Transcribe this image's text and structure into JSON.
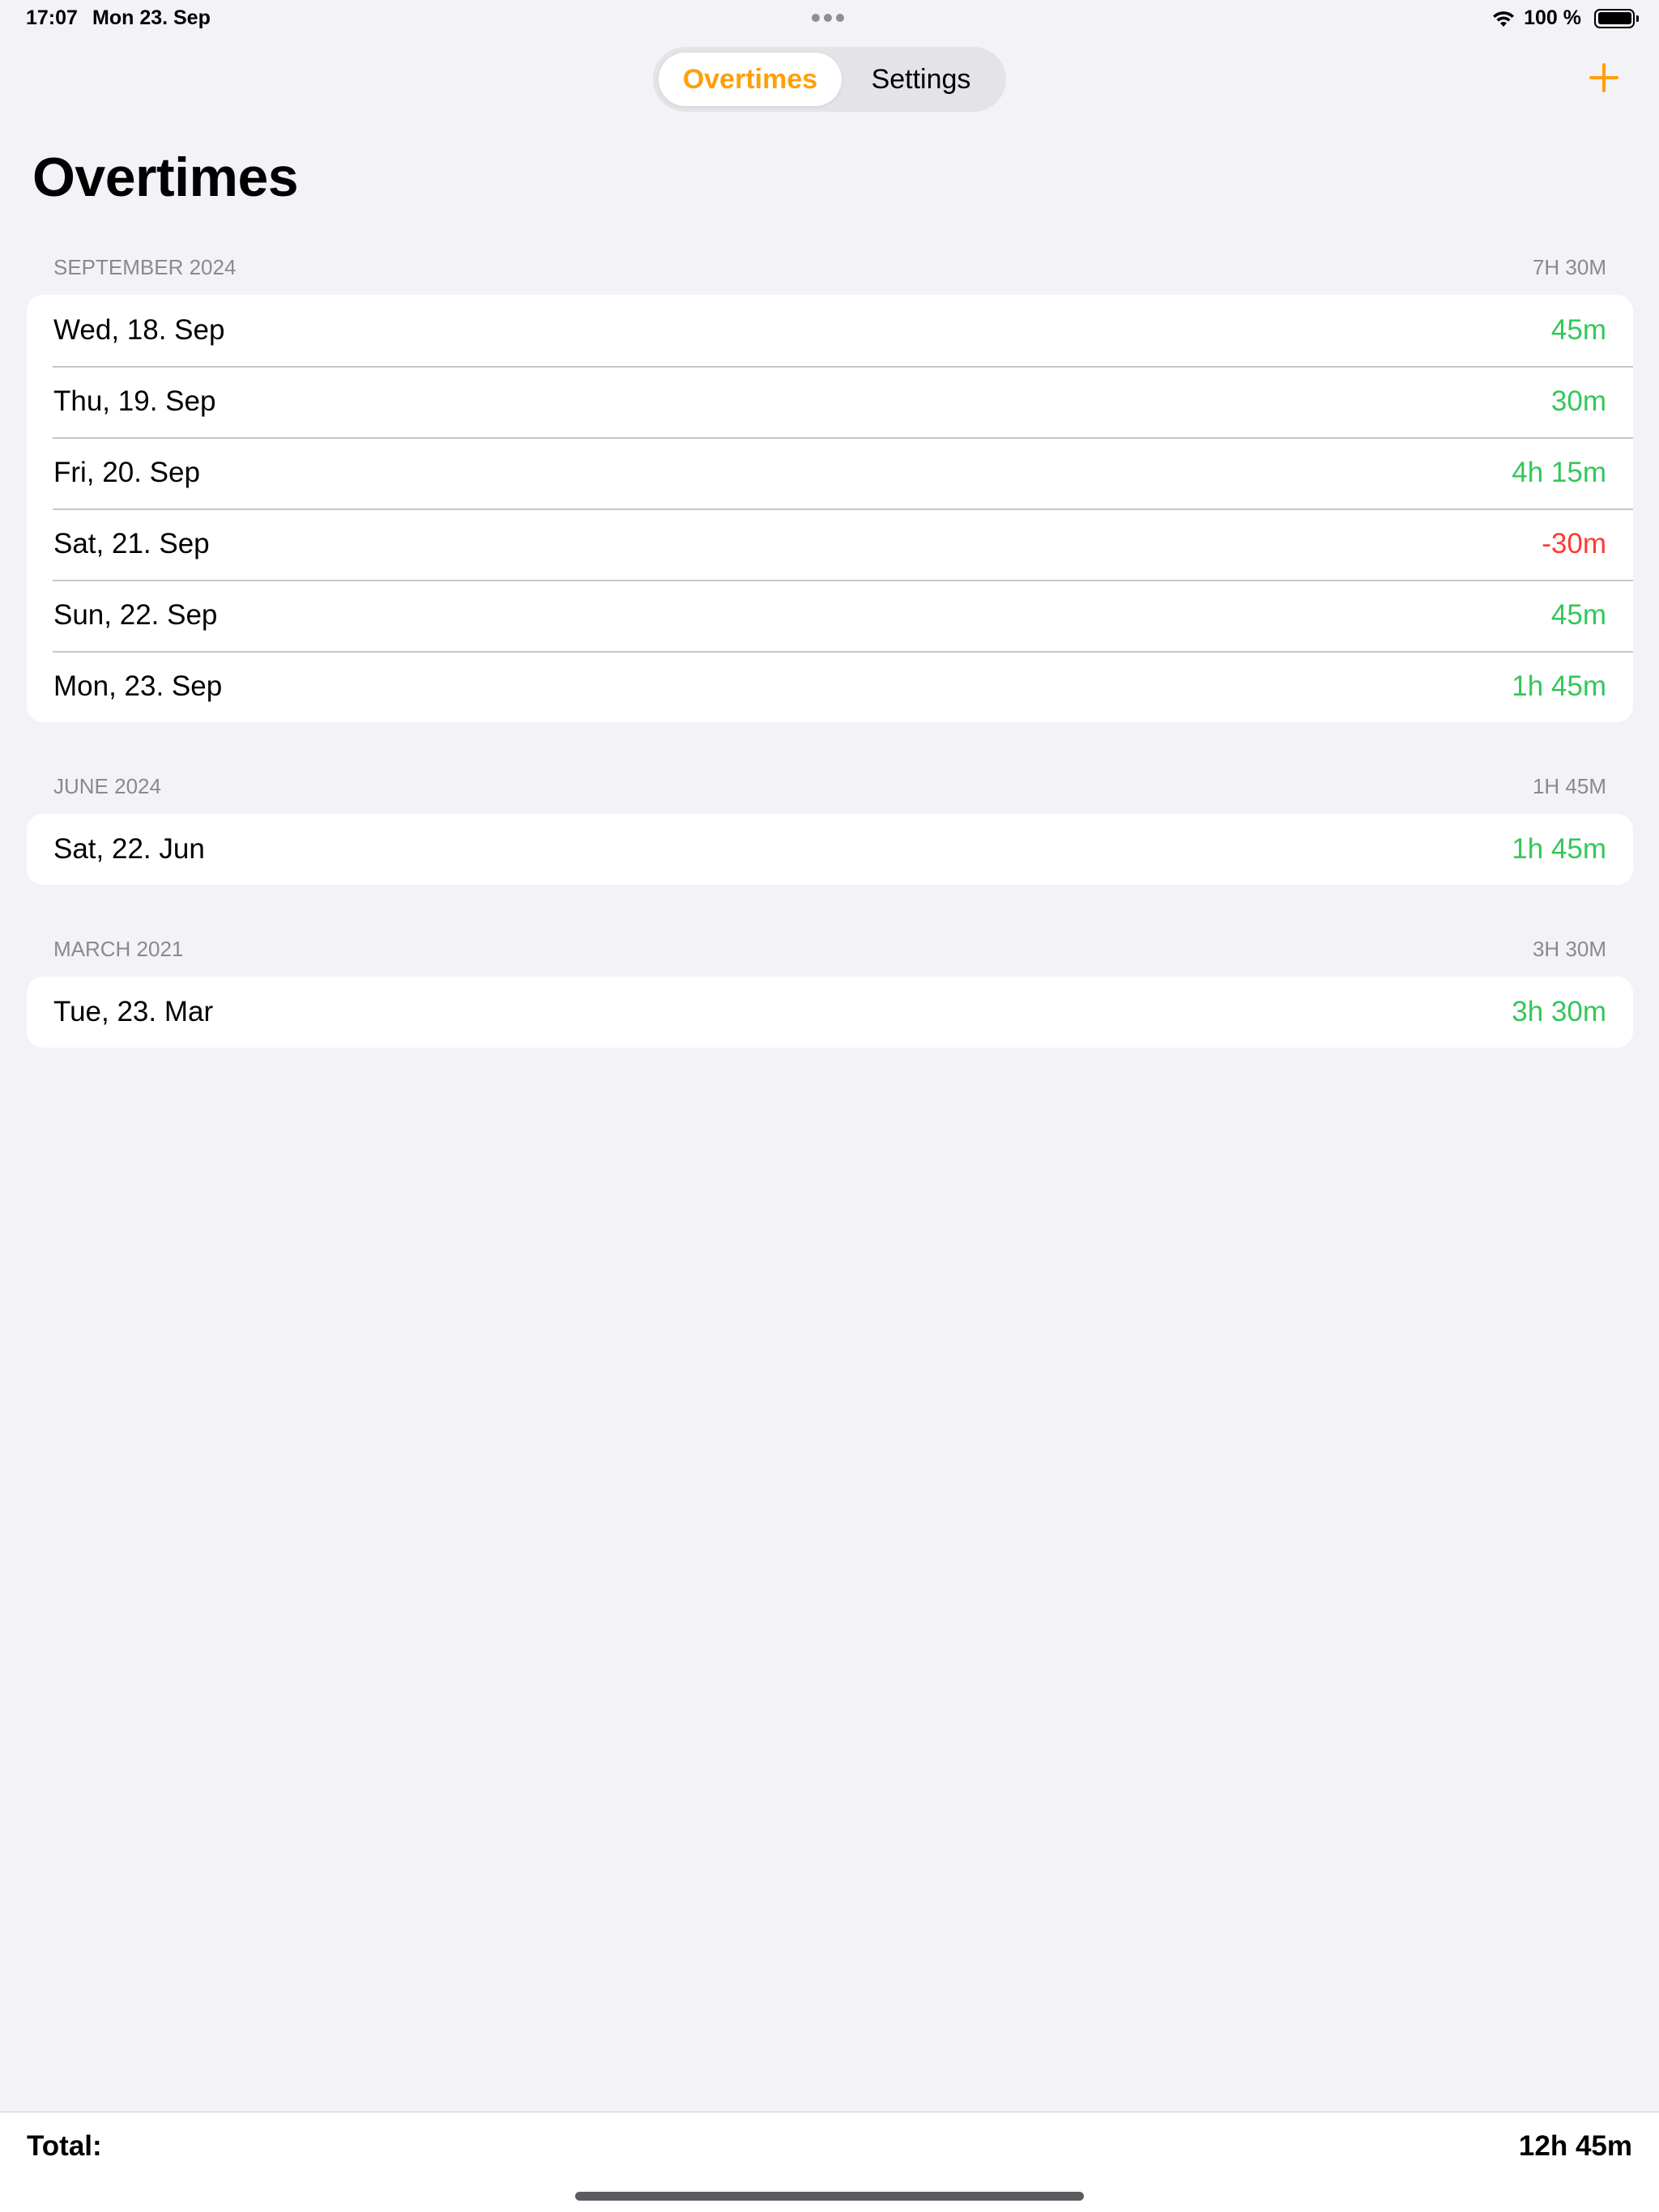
{
  "status_bar": {
    "time": "17:07",
    "date": "Mon 23. Sep",
    "battery": "100 %",
    "battery_level": 1.0,
    "icons": [
      "wifi-icon",
      "battery-icon",
      "multitasking-dots-icon"
    ]
  },
  "tabs": [
    {
      "label": "Overtimes",
      "selected": true
    },
    {
      "label": "Settings",
      "selected": false
    }
  ],
  "add_button_icon": "plus-icon",
  "title": "Overtimes",
  "sections": [
    {
      "header": "SEPTEMBER 2024",
      "total": "7H 30M",
      "rows": [
        {
          "date": "Wed, 18. Sep",
          "value": "45m",
          "sign": "positive"
        },
        {
          "date": "Thu, 19. Sep",
          "value": "30m",
          "sign": "positive"
        },
        {
          "date": "Fri, 20. Sep",
          "value": "4h 15m",
          "sign": "positive"
        },
        {
          "date": "Sat, 21. Sep",
          "value": "-30m",
          "sign": "negative"
        },
        {
          "date": "Sun, 22. Sep",
          "value": "45m",
          "sign": "positive"
        },
        {
          "date": "Mon, 23. Sep",
          "value": "1h 45m",
          "sign": "positive"
        }
      ]
    },
    {
      "header": "JUNE 2024",
      "total": "1H 45M",
      "rows": [
        {
          "date": "Sat, 22. Jun",
          "value": "1h 45m",
          "sign": "positive"
        }
      ]
    },
    {
      "header": "MARCH 2021",
      "total": "3H 30M",
      "rows": [
        {
          "date": "Tue, 23. Mar",
          "value": "3h 30m",
          "sign": "positive"
        }
      ]
    }
  ],
  "footer": {
    "label": "Total:",
    "value": "12h 45m"
  },
  "colors": {
    "accent": "#ff9f0a",
    "positive": "#34c759",
    "negative": "#ff3b30",
    "background": "#f2f2f7"
  }
}
